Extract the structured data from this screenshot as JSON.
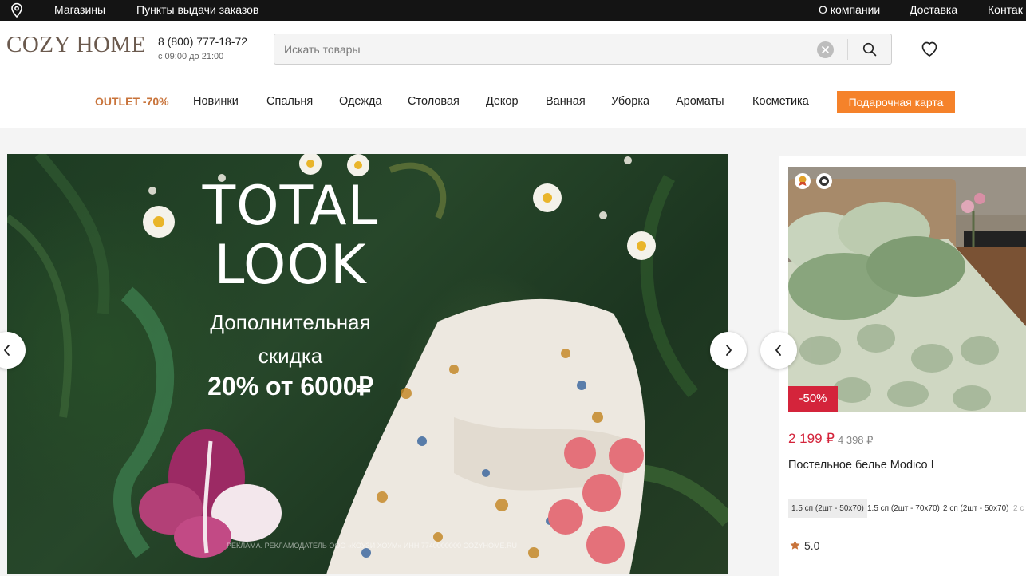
{
  "topbar": {
    "links": [
      "Магазины",
      "Пункты выдачи заказов"
    ],
    "right_links": [
      "О компании",
      "Доставка",
      "Контак"
    ]
  },
  "header": {
    "logo": "COZY HOME",
    "phone": "8 (800) 777-18-72",
    "hours": "с 09:00 до 21:00",
    "search_placeholder": "Искать товары"
  },
  "nav": {
    "items": [
      "OUTLET -70%",
      "Новинки",
      "Спальня",
      "Одежда",
      "Столовая",
      "Декор",
      "Ванная",
      "Уборка",
      "Ароматы",
      "Косметика"
    ],
    "gift_card": "Подарочная карта"
  },
  "banner": {
    "title_line1": "TOTAL",
    "title_line2": "LOOK",
    "subtitle_line1": "Дополнительная",
    "subtitle_line2": "скидка",
    "subtitle_line3": "20% от 6000₽",
    "legal": "РЕКЛАМА. РЕКЛАМОДАТЕЛЬ ООО «КОУЗИ ХОУМ» ИНН 7740000000 COZYHOME.RU"
  },
  "product": {
    "discount": "-50%",
    "price": "2 199 ₽",
    "old_price": "4 398 ₽",
    "name": "Постельное белье Modico I",
    "sizes": [
      "1.5 сп (2шт - 50х70)",
      "1.5 сп (2шт - 70х70)",
      "2 сп (2шт - 50х70)",
      "2 с"
    ],
    "selected_size_index": 0,
    "rating": "5.0"
  },
  "colors": {
    "topbar_bg": "#141414",
    "accent_orange": "#f5822a",
    "outlet_text": "#c8733a",
    "sale_red": "#d4243b",
    "logo": "#6b5a4e"
  },
  "icons": [
    "location-pin-icon",
    "clear-icon",
    "search-icon",
    "heart-icon",
    "chevron-left-icon",
    "chevron-right-icon",
    "star-icon"
  ]
}
